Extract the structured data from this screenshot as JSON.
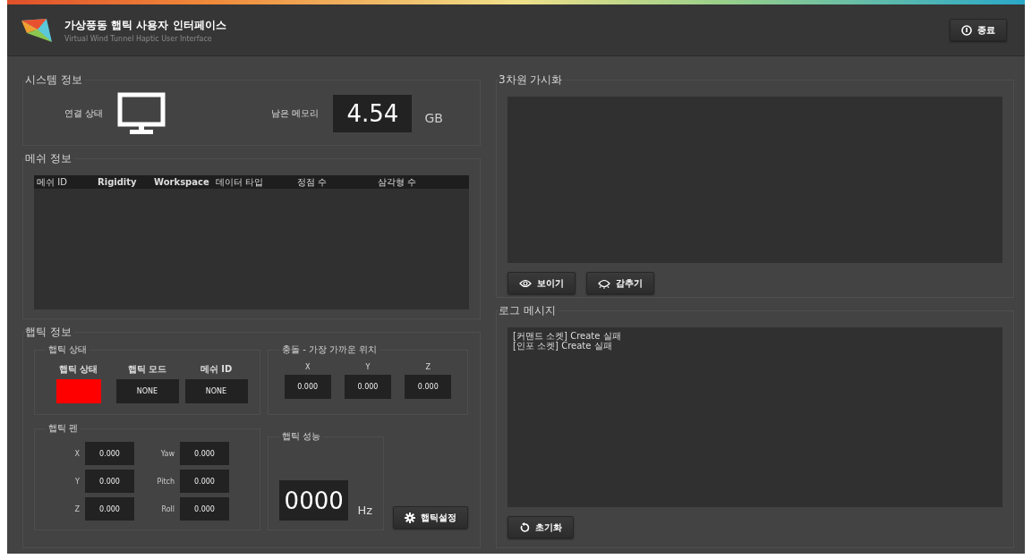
{
  "header": {
    "title": "가상풍동 햅틱 사용자 인터페이스",
    "subtitle": "Virtual Wind Tunnel Haptic User Interface",
    "exit_button": "종료"
  },
  "system_info": {
    "title": "시스템 정보",
    "connection_label": "연결 상태",
    "memory_label": "남은 메모리",
    "memory_value": "4.54",
    "memory_unit": "GB"
  },
  "mesh_info": {
    "title": "메쉬 정보",
    "columns": [
      "메쉬 ID",
      "Rigidity",
      "Workspace",
      "데이터 타입",
      "정점 수",
      "삼각형 수"
    ]
  },
  "haptic_info": {
    "title": "햅틱 정보",
    "status": {
      "title": "햅틱 상태",
      "items": [
        {
          "kind": "indicator",
          "label": "햅틱 상태",
          "color": "#ff0000"
        },
        {
          "kind": "value",
          "label": "햅틱 모드",
          "value": "NONE"
        },
        {
          "kind": "value",
          "label": "메쉬 ID",
          "value": "NONE"
        }
      ]
    },
    "collision": {
      "title": "충돌 - 가장 가까운 위치",
      "items": [
        {
          "label": "X",
          "value": "0.000"
        },
        {
          "label": "Y",
          "value": "0.000"
        },
        {
          "label": "Z",
          "value": "0.000"
        }
      ]
    },
    "pen": {
      "title": "햅틱 펜",
      "items": [
        {
          "label": "X",
          "value": "0.000"
        },
        {
          "label": "Yaw",
          "value": "0.000"
        },
        {
          "label": "Y",
          "value": "0.000"
        },
        {
          "label": "Pitch",
          "value": "0.000"
        },
        {
          "label": "Z",
          "value": "0.000"
        },
        {
          "label": "Roll",
          "value": "0.000"
        }
      ]
    },
    "performance": {
      "title": "햅틱 성능",
      "value": "0000",
      "unit": "Hz"
    },
    "settings_button": "햅틱설정"
  },
  "visualization": {
    "title": "3차원 가시화",
    "buttons": [
      {
        "kind": "show",
        "label": "보이기"
      },
      {
        "kind": "hide",
        "label": "감추기"
      }
    ]
  },
  "log": {
    "title": "로그 메시지",
    "lines": [
      "[커맨드 소켓] Create 실패",
      "[인포 소켓] Create 실패"
    ],
    "reset_button": "초기화"
  }
}
